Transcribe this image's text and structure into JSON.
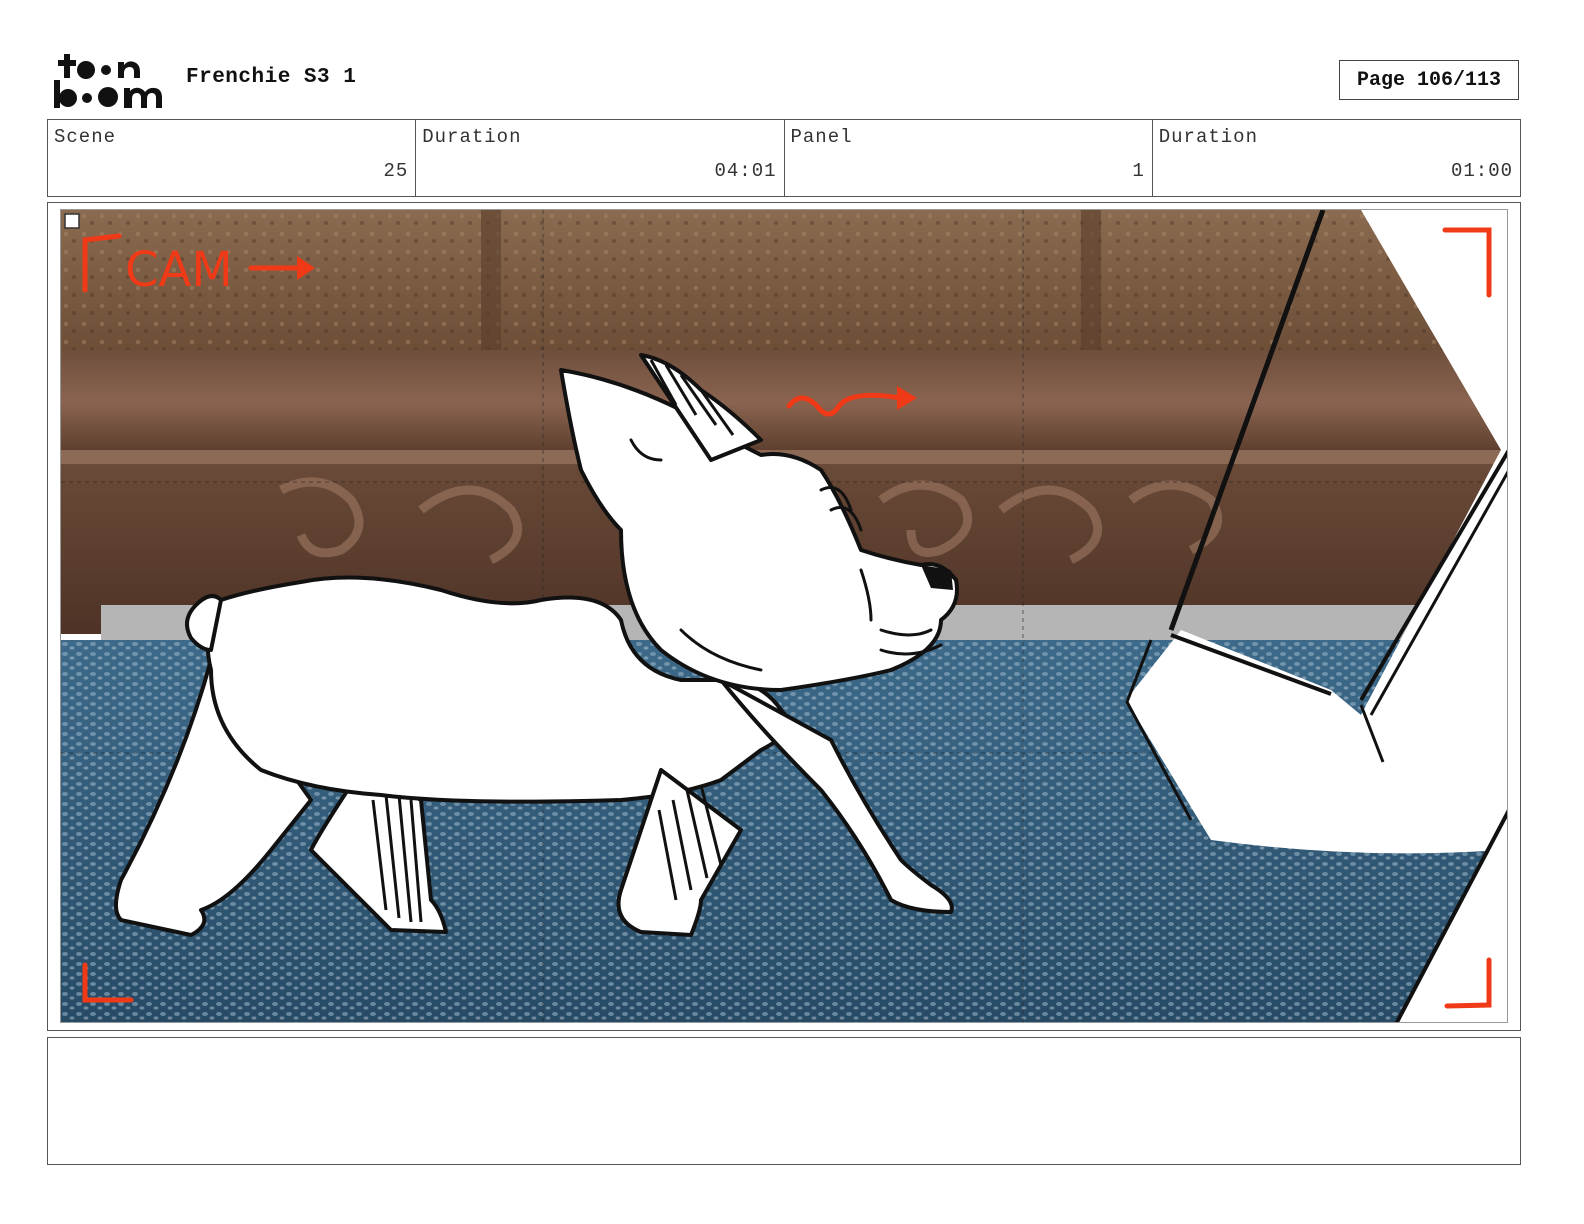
{
  "header": {
    "logo_text": "toon boom",
    "project_title": "Frenchie S3 1",
    "page_label": "Page 106/113"
  },
  "info": {
    "scene_label": "Scene",
    "scene_value": "25",
    "scene_duration_label": "Duration",
    "scene_duration_value": "04:01",
    "panel_label": "Panel",
    "panel_value": "1",
    "panel_duration_label": "Duration",
    "panel_duration_value": "01:00"
  },
  "panel": {
    "cam_annotation": "CAM",
    "annotation_color": "#f03a17"
  },
  "notes": {
    "text": ""
  }
}
